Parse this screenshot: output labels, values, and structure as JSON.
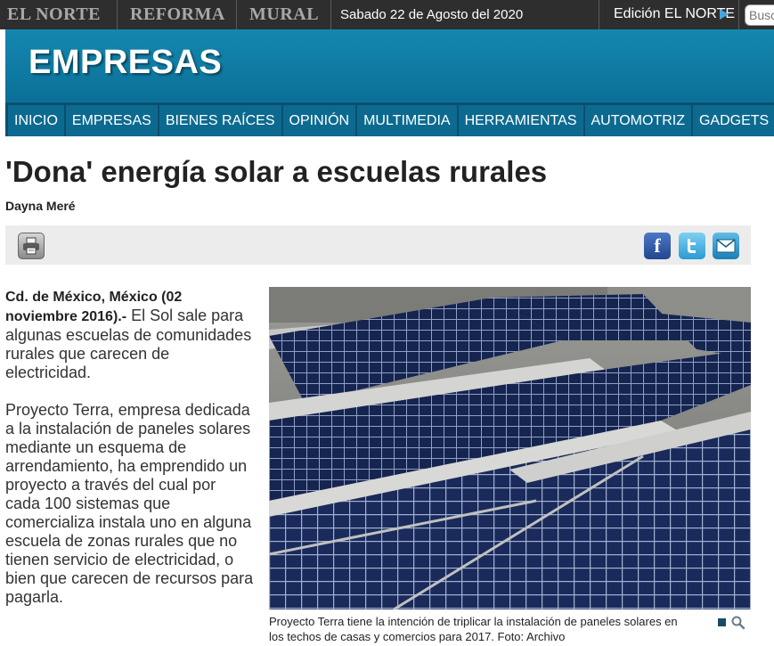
{
  "topbar": {
    "brands": [
      "EL NORTE",
      "REFORMA",
      "MURAL"
    ],
    "date": "Sabado 22 de Agosto del 2020",
    "edition_label": "Edición EL NORTE",
    "search_placeholder": "Busc"
  },
  "header": {
    "section_title": "EMPRESAS"
  },
  "nav": {
    "items": [
      "INICIO",
      "EMPRESAS",
      "BIENES RAÍCES",
      "OPINIÓN",
      "MULTIMEDIA",
      "HERRAMIENTAS",
      "AUTOMOTRIZ",
      "GADGETS"
    ]
  },
  "article": {
    "headline": "'Dona' energía solar a escuelas rurales",
    "byline": "Dayna Meré",
    "dateline": "Cd. de México, México (02 noviembre 2016).-",
    "paragraph_1_rest": " El Sol sale para algunas escuelas de comunidades rurales que carecen de electricidad.",
    "paragraph_2": "Proyecto Terra, empresa dedicada a la instalación de paneles solares mediante un esquema de arrendamiento, ha emprendido un proyecto a través del cual por cada 100 sistemas que comercializa instala uno en alguna escuela de zonas rurales que no tienen servicio de electricidad, o bien que carecen de recursos para pagarla.",
    "photo_caption": "Proyecto Terra tiene la intención de triplicar la instalación de paneles solares en los techos de casas y comercios para 2017. Foto: Archivo"
  },
  "icons": {
    "print": "printer-icon",
    "facebook": "facebook-icon",
    "twitter": "twitter-icon",
    "email": "email-icon",
    "edition_arrow": "triangle-right-icon",
    "zoom": "magnifier-icon"
  },
  "colors": {
    "topbar": "#2e2e2e",
    "header": "#1488b0",
    "nav_bg": "#0b4f6e",
    "nav_item": "#0c6a90",
    "accent_arrow": "#4aa3df"
  }
}
